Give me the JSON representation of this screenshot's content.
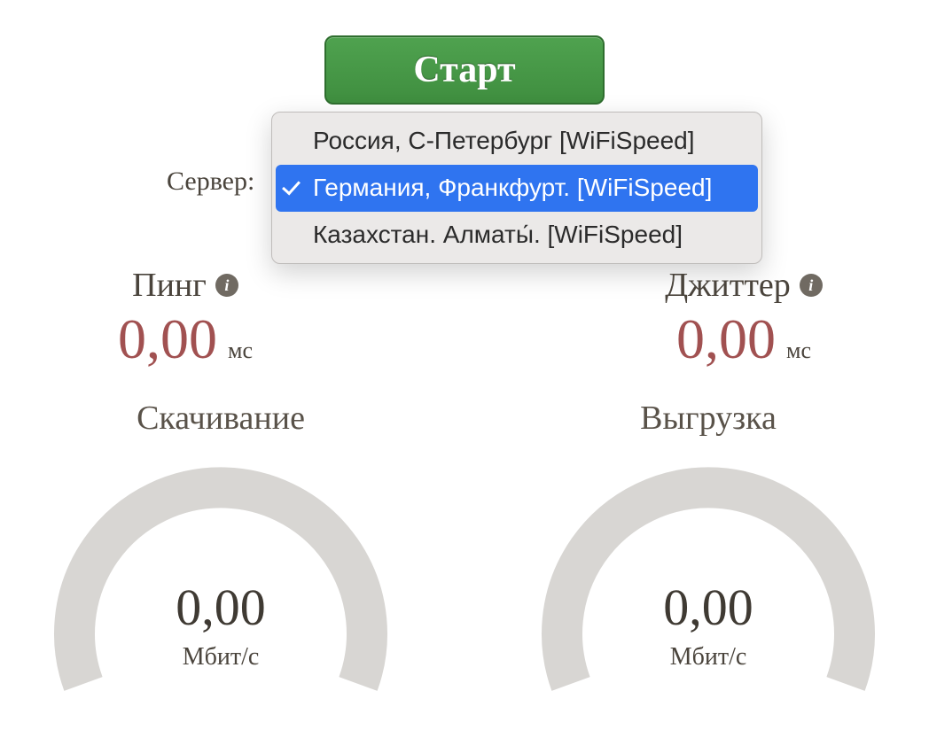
{
  "start_label": "Старт",
  "server_label": "Сервер:",
  "server_options": [
    {
      "label": "Россия, С-Петербург [WiFiSpeed]",
      "selected": false
    },
    {
      "label": "Германия, Франкфурт. [WiFiSpeed]",
      "selected": true
    },
    {
      "label": "Казахстан. Алматы́. [WiFiSpeed]",
      "selected": false
    }
  ],
  "ping": {
    "title": "Пинг",
    "value": "0,00",
    "unit": "мс"
  },
  "jitter": {
    "title": "Джиттер",
    "value": "0,00",
    "unit": "мс"
  },
  "download": {
    "title": "Скачивание",
    "value": "0,00",
    "unit": "Мбит/с"
  },
  "upload": {
    "title": "Выгрузка",
    "value": "0,00",
    "unit": "Мбит/с"
  }
}
